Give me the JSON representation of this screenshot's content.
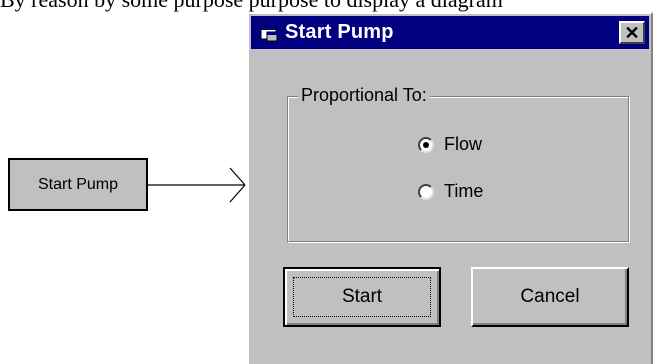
{
  "caption": {
    "text": "By reason by some purpose purpose to display a diagram"
  },
  "flowchart": {
    "box_label": "Start Pump"
  },
  "dialog": {
    "title": "Start Pump",
    "close_label": "✕",
    "group": {
      "legend": "Proportional To:",
      "options": [
        {
          "label": "Flow",
          "selected": true
        },
        {
          "label": "Time",
          "selected": false
        }
      ]
    },
    "buttons": {
      "start_label": "Start",
      "cancel_label": "Cancel"
    }
  },
  "colors": {
    "titlebar": "#000080",
    "dialog_face": "#c0c0c0",
    "flow_box": "#c0c0c0"
  }
}
